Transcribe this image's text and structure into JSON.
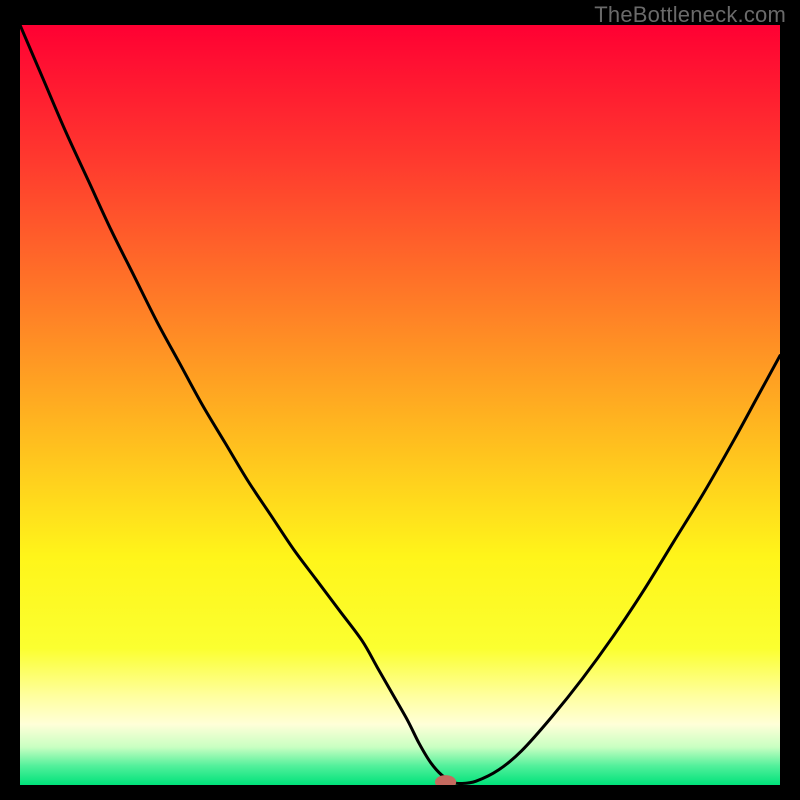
{
  "watermark": "TheBottleneck.com",
  "chart_data": {
    "type": "line",
    "title": "",
    "xlabel": "",
    "ylabel": "",
    "xlim": [
      0,
      100
    ],
    "ylim": [
      0,
      100
    ],
    "grid": false,
    "legend": false,
    "background_gradient": {
      "stops": [
        {
          "offset": 0.0,
          "color": "#ff0033"
        },
        {
          "offset": 0.18,
          "color": "#ff3a2e"
        },
        {
          "offset": 0.36,
          "color": "#ff7a27"
        },
        {
          "offset": 0.54,
          "color": "#ffbb1f"
        },
        {
          "offset": 0.7,
          "color": "#fff51a"
        },
        {
          "offset": 0.82,
          "color": "#fbff30"
        },
        {
          "offset": 0.88,
          "color": "#ffff9a"
        },
        {
          "offset": 0.92,
          "color": "#ffffd8"
        },
        {
          "offset": 0.95,
          "color": "#c9ffc2"
        },
        {
          "offset": 0.975,
          "color": "#52f09b"
        },
        {
          "offset": 1.0,
          "color": "#00e27a"
        }
      ]
    },
    "series": [
      {
        "name": "bottleneck-curve",
        "color": "#000000",
        "x": [
          0.0,
          3,
          6,
          9,
          12,
          15,
          18,
          21,
          24,
          27,
          30,
          33,
          36,
          39,
          42,
          45,
          47,
          49,
          51,
          52.5,
          54,
          55.5,
          57,
          58,
          60,
          63,
          66,
          70,
          74,
          78,
          82,
          86,
          90,
          94,
          97,
          100
        ],
        "y": [
          100,
          93,
          86,
          79.5,
          73,
          67,
          61,
          55.5,
          50,
          45,
          40,
          35.5,
          31,
          27,
          23,
          19,
          15.5,
          12,
          8.5,
          5.5,
          3.0,
          1.3,
          0.4,
          0.2,
          0.5,
          2.0,
          4.5,
          9.0,
          14.0,
          19.5,
          25.5,
          32.0,
          38.5,
          45.5,
          51.0,
          56.5
        ]
      }
    ],
    "marker": {
      "name": "optimal-point",
      "x": 56.0,
      "y": 0.4,
      "color": "#c46a5f",
      "rx": 1.4,
      "ry": 0.9
    }
  }
}
